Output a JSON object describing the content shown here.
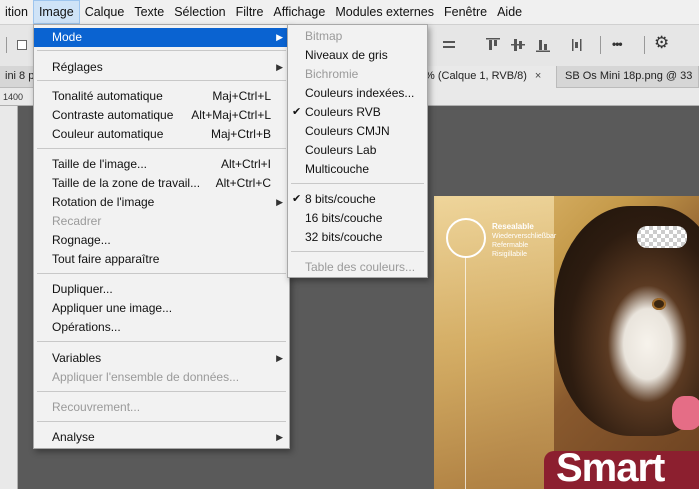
{
  "menubar": {
    "items": [
      "ition",
      "Image",
      "Calque",
      "Texte",
      "Sélection",
      "Filtre",
      "Affichage",
      "Modules externes",
      "Fenêtre",
      "Aide"
    ]
  },
  "tabs": {
    "tab1": "ini 8 pi",
    "tab2": "% (Calque 1, RVB/8)",
    "tab2_close": "×",
    "tab3": "SB Os Mini 18p.png @ 33"
  },
  "ruler": {
    "label": "1400"
  },
  "image_menu": {
    "mode": "Mode",
    "reglages": "Réglages",
    "tonalite": "Tonalité automatique",
    "tonalite_sc": "Maj+Ctrl+L",
    "contraste": "Contraste automatique",
    "contraste_sc": "Alt+Maj+Ctrl+L",
    "couleur": "Couleur automatique",
    "couleur_sc": "Maj+Ctrl+B",
    "taille_image": "Taille de l'image...",
    "taille_image_sc": "Alt+Ctrl+I",
    "taille_zone": "Taille de la zone de travail...",
    "taille_zone_sc": "Alt+Ctrl+C",
    "rotation": "Rotation de l'image",
    "recadrer": "Recadrer",
    "rognage": "Rognage...",
    "tout_faire": "Tout faire apparaître",
    "dupliquer": "Dupliquer...",
    "appliquer_image": "Appliquer une image...",
    "operations": "Opérations...",
    "variables": "Variables",
    "appliquer_ensemble": "Appliquer l'ensemble de données...",
    "recouvrement": "Recouvrement...",
    "analyse": "Analyse"
  },
  "mode_submenu": {
    "bitmap": "Bitmap",
    "niveaux_gris": "Niveaux de gris",
    "bichromie": "Bichromie",
    "couleurs_indexees": "Couleurs indexées...",
    "couleurs_rvb": "Couleurs RVB",
    "couleurs_cmjn": "Couleurs CMJN",
    "couleurs_lab": "Couleurs Lab",
    "multicouche": "Multicouche",
    "bits8": "8 bits/couche",
    "bits16": "16 bits/couche",
    "bits32": "32 bits/couche",
    "table_couleurs": "Table des couleurs..."
  },
  "document": {
    "reseal_title": "Resealable",
    "reseal_l1": "Wiederverschließbar",
    "reseal_l2": "Refermable",
    "reseal_l3": "Risigillabile",
    "brand": "Smart"
  },
  "icons": {
    "check": "✔",
    "submenu_arrow": "▶",
    "more": "•••",
    "gear": "⚙"
  },
  "colors": {
    "highlight": "#0a63d1",
    "menu_bg": "#f2f2f2",
    "workspace": "#5a5a5a",
    "brand_red": "#8c1f2f"
  }
}
